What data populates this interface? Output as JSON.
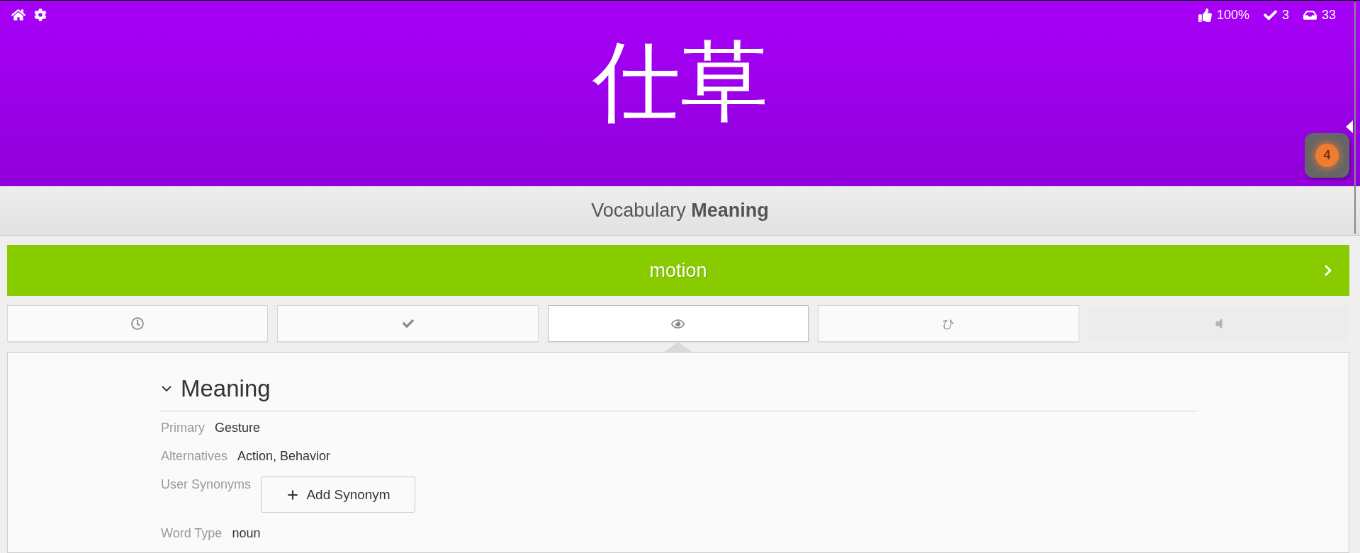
{
  "header": {
    "stats": [
      {
        "kind": "approval",
        "value": "100%"
      },
      {
        "kind": "completed",
        "value": "3"
      },
      {
        "kind": "remaining",
        "value": "33"
      }
    ],
    "character": "仕草"
  },
  "side_widget": {
    "count": "4"
  },
  "subheader": {
    "title": "Vocabulary **Meaning**"
  },
  "answer": {
    "text": "motion",
    "correct": true
  },
  "buttons": [
    {
      "kind": "clock",
      "selected": false,
      "disabled": false
    },
    {
      "kind": "check",
      "selected": false,
      "disabled": false
    },
    {
      "kind": "eye",
      "selected": true,
      "disabled": false
    },
    {
      "kind": "kana",
      "label": "ひ",
      "selected": false,
      "disabled": false
    },
    {
      "kind": "audio",
      "selected": false,
      "disabled": true
    }
  ],
  "section": {
    "title": "Meaning",
    "expanded": true,
    "rows": [
      {
        "kind": "text",
        "label": "Primary",
        "value": "Gesture"
      },
      {
        "kind": "text",
        "label": "Alternatives",
        "value": "Action, Behavior"
      },
      {
        "kind": "button",
        "label": "User Synonyms",
        "button": "Add Synonym"
      },
      {
        "kind": "text",
        "label": "Word Type",
        "value": "noun"
      }
    ]
  }
}
